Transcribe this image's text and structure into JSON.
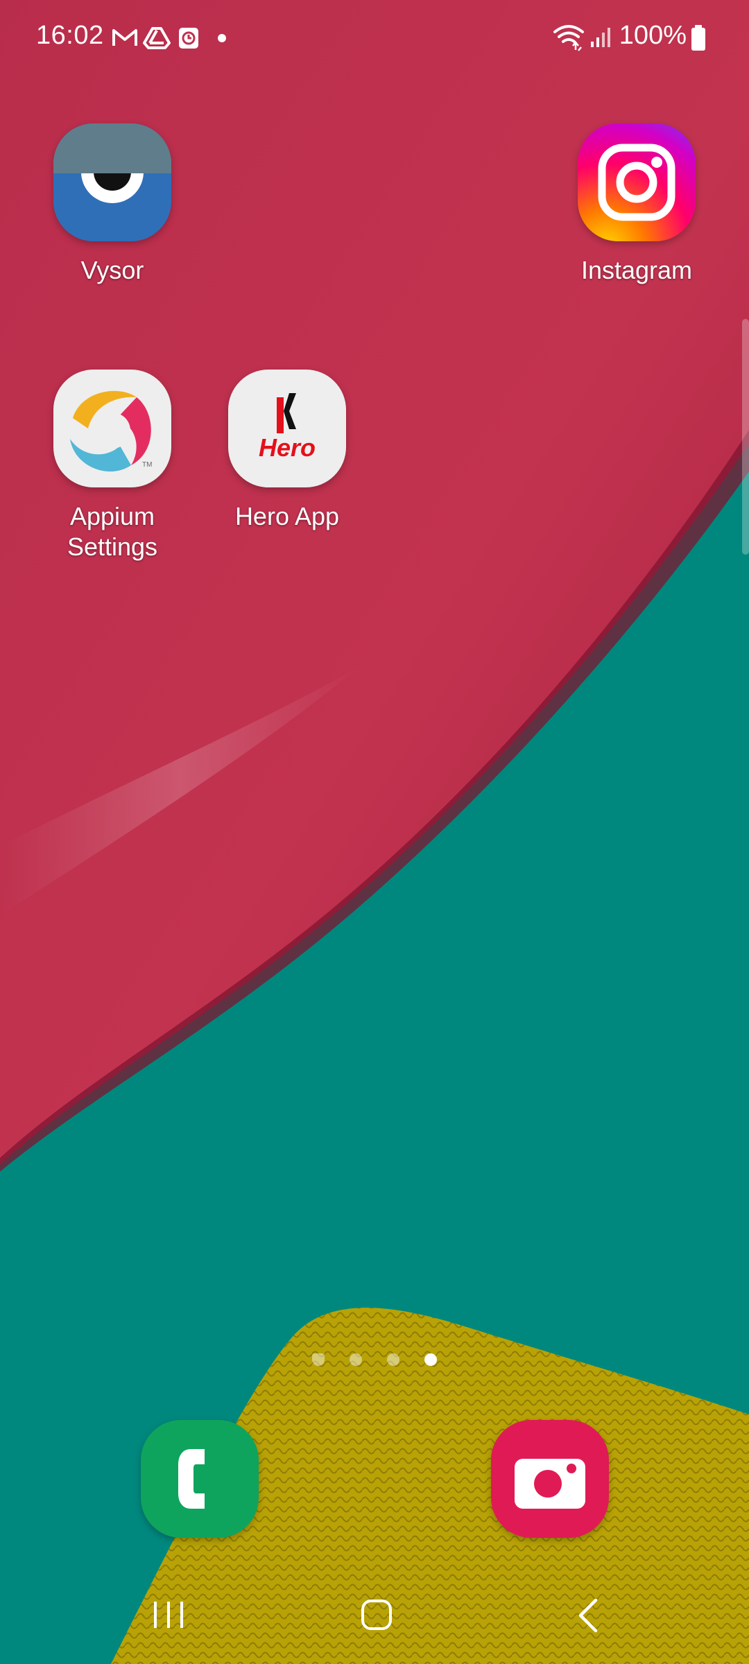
{
  "status_bar": {
    "time": "16:02",
    "notification_icons": [
      "gmail-icon",
      "drive-icon",
      "clock-app-icon",
      "more-dot-icon"
    ],
    "system_icons": [
      "wifi-icon",
      "signal-icon",
      "battery-icon"
    ],
    "battery": "100%"
  },
  "home": {
    "apps": [
      {
        "name": "Vysor",
        "icon": "vysor-icon"
      },
      {
        "name": "Instagram",
        "icon": "instagram-icon"
      },
      {
        "name": "Appium\nSettings",
        "icon": "appium-icon"
      },
      {
        "name": "Hero App",
        "icon": "hero-icon"
      }
    ],
    "hero_logo_text": "Hero"
  },
  "page_indicator": {
    "pages": 4,
    "current": 4,
    "first_is_home": true
  },
  "dock": [
    {
      "name": "Phone",
      "icon": "phone-icon"
    },
    {
      "name": "Camera",
      "icon": "camera-icon"
    }
  ],
  "nav": [
    "recent-apps",
    "home",
    "back"
  ],
  "colors": {
    "wallpaper_pink": "#c0304f",
    "wallpaper_teal": "#00887e",
    "wallpaper_yellow": "#b8a206",
    "phone_green": "#0ea45d",
    "camera_red": "#e01a55"
  }
}
